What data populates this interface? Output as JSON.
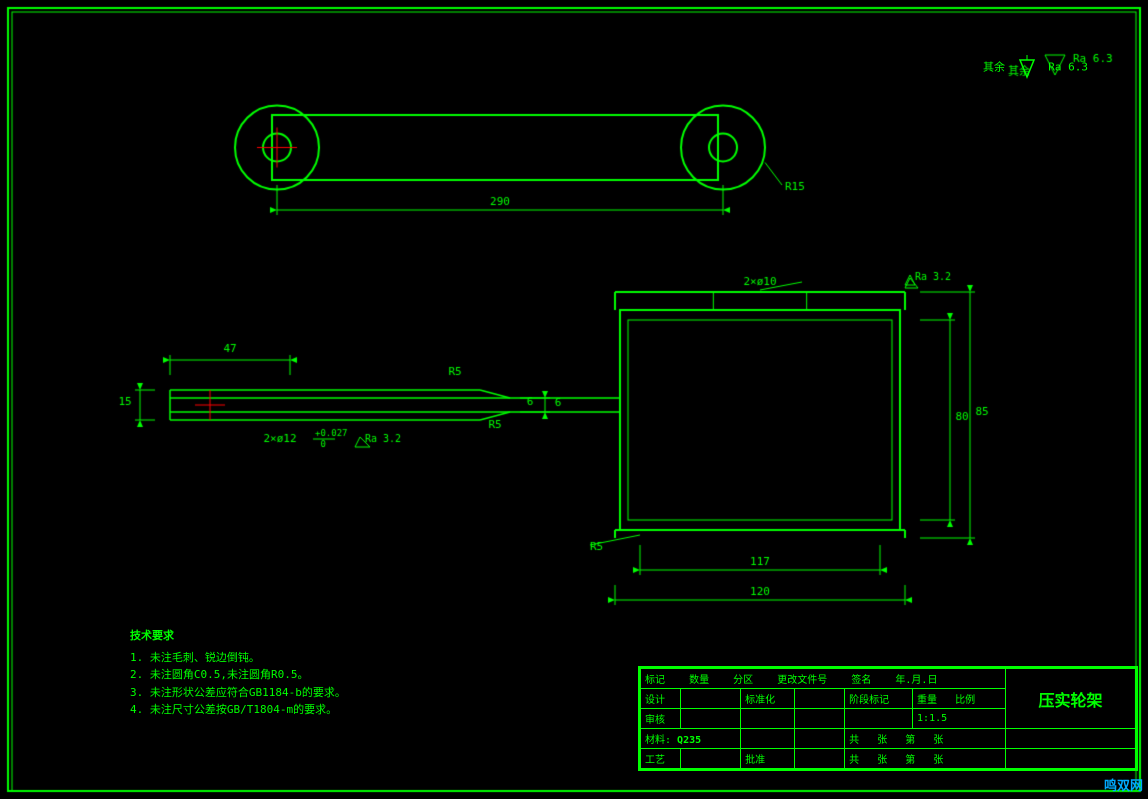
{
  "drawing": {
    "background": "#000000",
    "line_color": "#00ff00",
    "title": "压实轮架",
    "material": "Q235",
    "scale": "1:1.5"
  },
  "tech_requirements": {
    "title": "技术要求",
    "items": [
      "1. 未注毛刺、锐边倒钝。",
      "2. 未注圆角C0.5,未注圆角R0.5。",
      "3. 未注形状公差应符合GB1184-b的要求。",
      "4. 未注尺寸公差按GB/T1804-m的要求。"
    ]
  },
  "title_block": {
    "rows": [
      [
        "标记",
        "数量",
        "分区",
        "更改文件号",
        "签名",
        "年.月.日"
      ],
      [
        "设计",
        "",
        "标准化",
        "",
        "阶段标记",
        "重量",
        "比例"
      ],
      [
        "审核",
        "",
        "",
        "",
        "",
        "",
        "1:1.5"
      ],
      [
        "工艺",
        "",
        "批准",
        "",
        "共",
        "张",
        "第",
        "张"
      ]
    ],
    "material_label": "Q235",
    "title_label": "压实轮架"
  },
  "dimensions": {
    "top_view_width": "290",
    "top_view_radius": "R15",
    "side_dim_47": "47",
    "side_dim_R5_top": "R5",
    "side_dim_15": "15",
    "side_dim_6": "6",
    "hole_2x12": "2×ø12",
    "hole_tolerance": "+0.027\n 0",
    "roughness_32_left": "Ra 3.2",
    "main_width": "117",
    "main_bottom": "120",
    "main_height_80": "80",
    "main_height_85": "85",
    "hole_2x10": "2×ø10",
    "roughness_32_right": "Ra 3.2",
    "roughness_63": "Ra 6.3",
    "R5_bottom": "R5"
  },
  "surface_finish_global": {
    "symbol": "其余",
    "value": "Ra 6.3"
  },
  "watermark": "鸣双网"
}
